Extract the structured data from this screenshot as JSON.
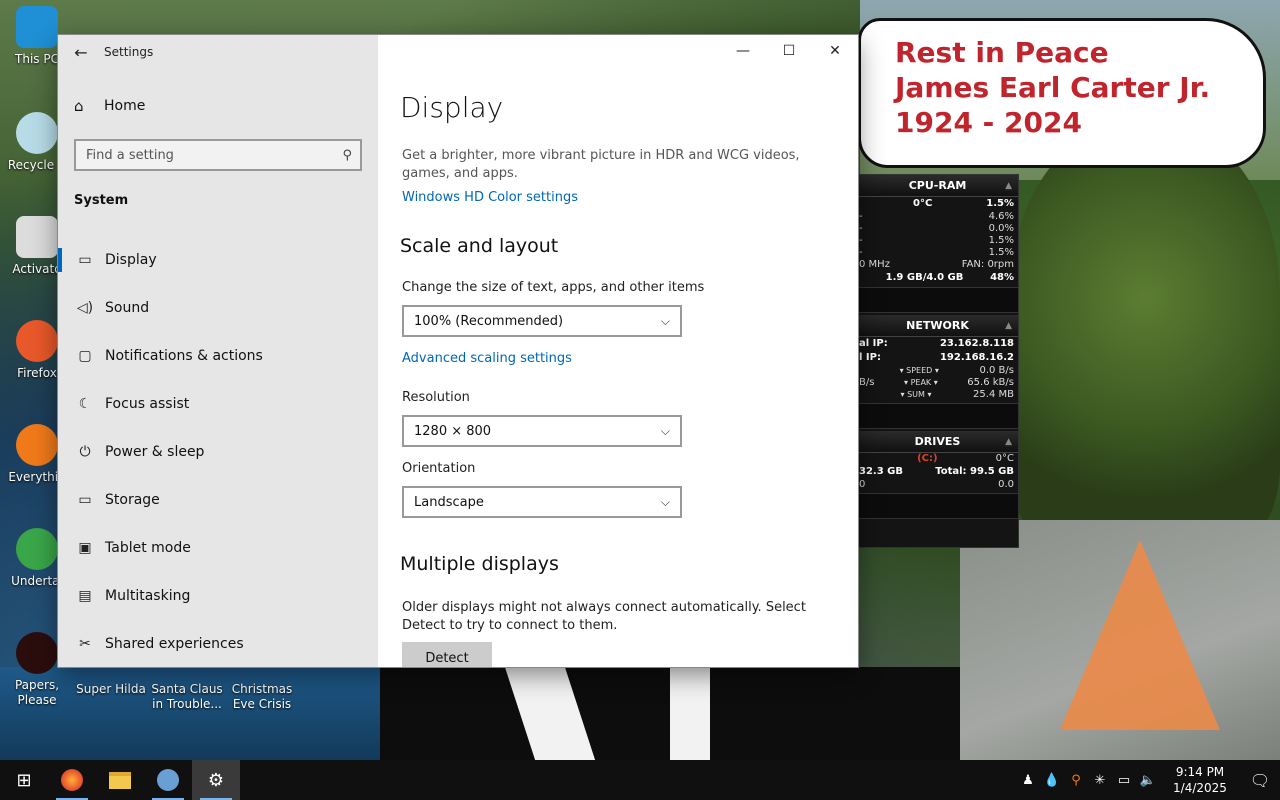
{
  "wallpaper": {
    "bubble_lines": [
      "Rest in Peace",
      "James Earl Carter Jr.",
      "1924 - 2024"
    ]
  },
  "desktop_icons": [
    {
      "label": "This PC",
      "color": "#1f8fd6"
    },
    {
      "label": "Recycle B",
      "color": "#b7dce8"
    },
    {
      "label": "Activato",
      "color": "#dcdcdc"
    },
    {
      "label": "Firefox",
      "color": "#e8582a"
    },
    {
      "label": "Everythin",
      "color": "#f07a1a"
    },
    {
      "label": "Undertal",
      "color": "#3aa64a"
    },
    {
      "label": "Papers, Please",
      "color": "#2b0d0d"
    },
    {
      "label": "Super Hilda",
      "color": "#f0f0f0"
    },
    {
      "label": "Santa Claus in Trouble...",
      "color": "#c8a070"
    },
    {
      "label": "Christmas Eve Crisis",
      "color": "#d0d0d0"
    }
  ],
  "gadget": {
    "cpu": {
      "title": "CPU-RAM",
      "temp": "0°C",
      "load": "1.5%",
      "cores": [
        "4.6%",
        "0.0%",
        "1.5%",
        "1.5%"
      ],
      "freq": "0 MHz",
      "fan": "FAN: 0rpm",
      "ram": "1.9 GB/4.0 GB",
      "ram_pct": "48%"
    },
    "network": {
      "title": "NETWORK",
      "ext_label": "al IP:",
      "ext_ip": "23.162.8.118",
      "int_label": "l IP:",
      "int_ip": "192.168.16.2",
      "speed_label": "▾ SPEED ▾",
      "speed": "0.0 B/s",
      "peak_label": "▾ PEAK ▾",
      "peak": "65.6 kB/s",
      "sum_label": "▾ SUM ▾",
      "sum": "25.4 MB",
      "left_unit": "B/s"
    },
    "drives": {
      "title": "DRIVES",
      "drive": "(C:)",
      "temp": "0°C",
      "free": "32.3 GB",
      "total": "Total: 99.5 GB",
      "read": "0",
      "write": "0.0"
    }
  },
  "window": {
    "title": "Settings",
    "sidebar": {
      "home": "Home",
      "search_placeholder": "Find a setting",
      "section": "System",
      "items": [
        {
          "label": "Display",
          "icon": "monitor-icon",
          "glyph": "▭"
        },
        {
          "label": "Sound",
          "icon": "speaker-icon",
          "glyph": "◁)"
        },
        {
          "label": "Notifications & actions",
          "icon": "notification-icon",
          "glyph": "▢"
        },
        {
          "label": "Focus assist",
          "icon": "moon-icon",
          "glyph": "☾"
        },
        {
          "label": "Power & sleep",
          "icon": "power-icon",
          "glyph": "⏻"
        },
        {
          "label": "Storage",
          "icon": "storage-icon",
          "glyph": "▭"
        },
        {
          "label": "Tablet mode",
          "icon": "tablet-icon",
          "glyph": "▣"
        },
        {
          "label": "Multitasking",
          "icon": "multitasking-icon",
          "glyph": "▤"
        },
        {
          "label": "Shared experiences",
          "icon": "shared-icon",
          "glyph": "✂"
        }
      ]
    },
    "main": {
      "title": "Display",
      "hdr_desc": "Get a brighter, more vibrant picture in HDR and WCG videos, games, and apps.",
      "hdr_link": "Windows HD Color settings",
      "scale_heading": "Scale and layout",
      "scale_label": "Change the size of text, apps, and other items",
      "scale_value": "100% (Recommended)",
      "advanced_link": "Advanced scaling settings",
      "resolution_label": "Resolution",
      "resolution_value": "1280 × 800",
      "orientation_label": "Orientation",
      "orientation_value": "Landscape",
      "multi_heading": "Multiple displays",
      "multi_desc": "Older displays might not always connect automatically. Select Detect to try to connect to them.",
      "detect_label": "Detect"
    }
  },
  "taskbar": {
    "time": "9:14 PM",
    "date": "1/4/2025"
  },
  "colors": {
    "accent": "#0067c0",
    "link": "#0067b8",
    "bubble_text": "#c0242c"
  }
}
